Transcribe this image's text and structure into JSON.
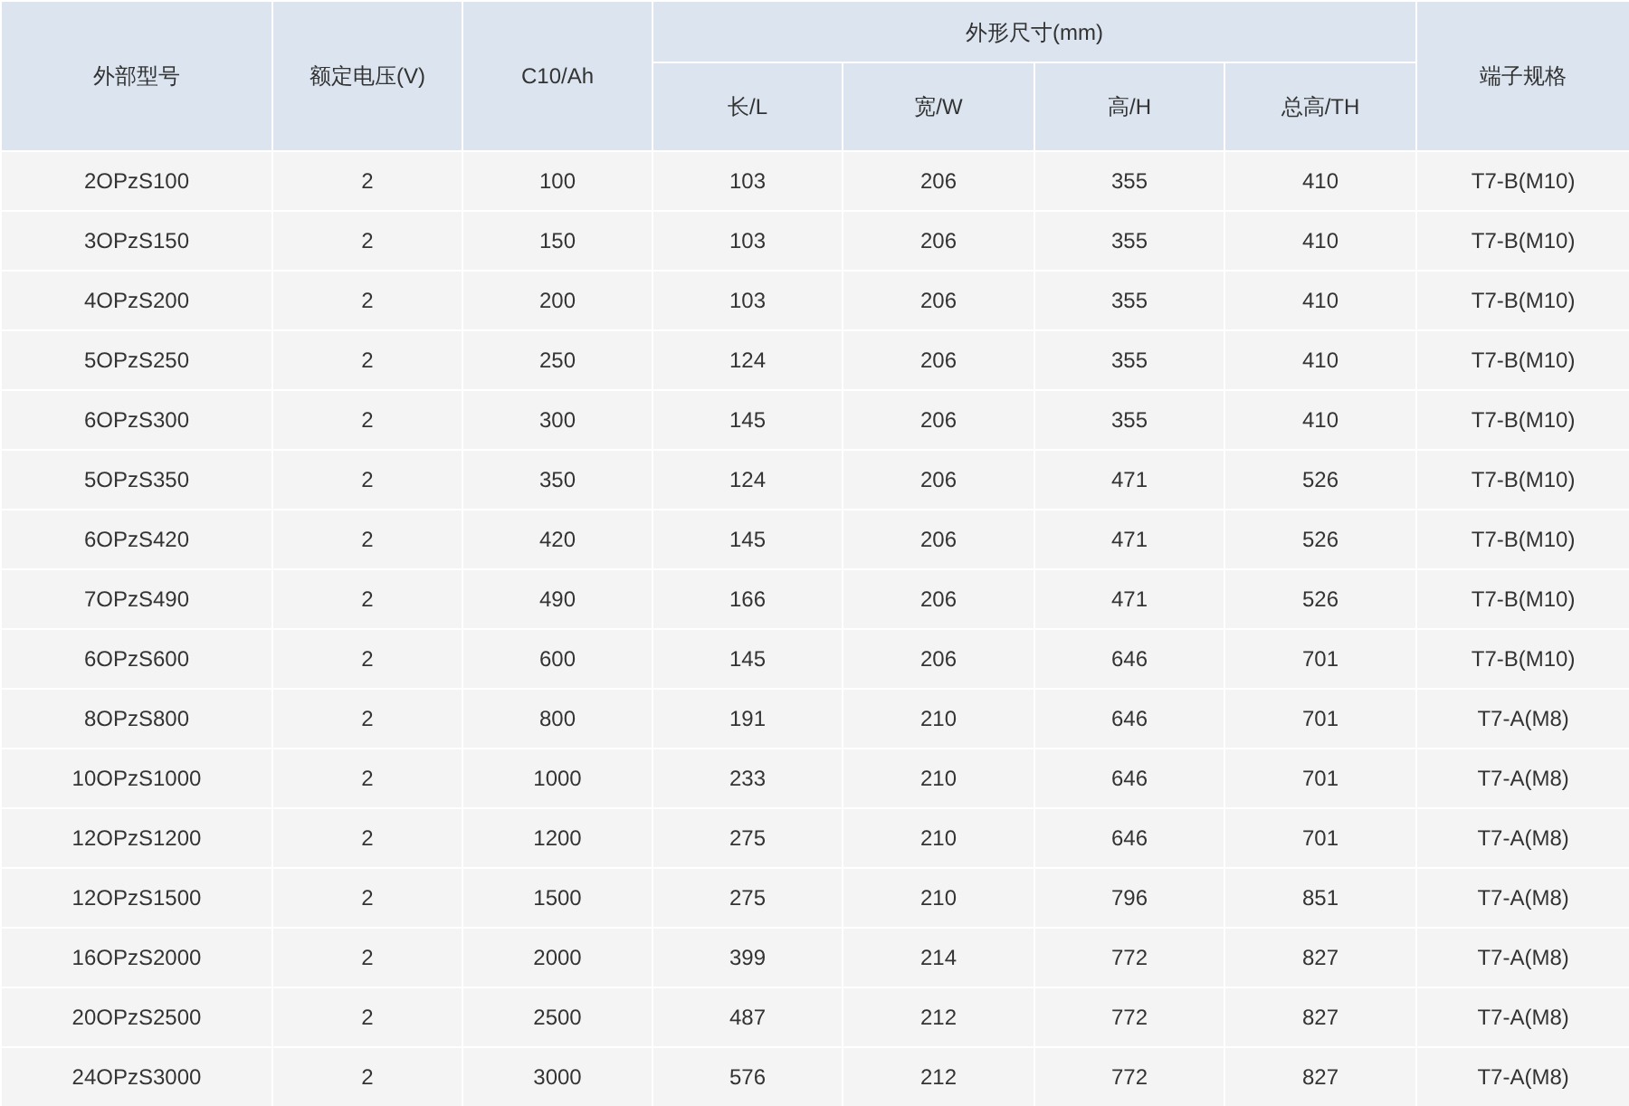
{
  "table": {
    "header_rows": [
      [
        {
          "label": "外部型号",
          "rowspan": 2
        },
        {
          "label": "额定电压(V)",
          "rowspan": 2
        },
        {
          "label": "C10/Ah",
          "rowspan": 2
        },
        {
          "label": "外形尺寸(mm)",
          "colspan": 4
        },
        {
          "label": "端子规格",
          "rowspan": 2
        }
      ],
      [
        {
          "label": "长/L"
        },
        {
          "label": "宽/W"
        },
        {
          "label": "高/H"
        },
        {
          "label": "总高/TH"
        }
      ]
    ],
    "rows": [
      [
        "2OPzS100",
        "2",
        "100",
        "103",
        "206",
        "355",
        "410",
        "T7-B(M10)"
      ],
      [
        "3OPzS150",
        "2",
        "150",
        "103",
        "206",
        "355",
        "410",
        "T7-B(M10)"
      ],
      [
        "4OPzS200",
        "2",
        "200",
        "103",
        "206",
        "355",
        "410",
        "T7-B(M10)"
      ],
      [
        "5OPzS250",
        "2",
        "250",
        "124",
        "206",
        "355",
        "410",
        "T7-B(M10)"
      ],
      [
        "6OPzS300",
        "2",
        "300",
        "145",
        "206",
        "355",
        "410",
        "T7-B(M10)"
      ],
      [
        "5OPzS350",
        "2",
        "350",
        "124",
        "206",
        "471",
        "526",
        "T7-B(M10)"
      ],
      [
        "6OPzS420",
        "2",
        "420",
        "145",
        "206",
        "471",
        "526",
        "T7-B(M10)"
      ],
      [
        "7OPzS490",
        "2",
        "490",
        "166",
        "206",
        "471",
        "526",
        "T7-B(M10)"
      ],
      [
        "6OPzS600",
        "2",
        "600",
        "145",
        "206",
        "646",
        "701",
        "T7-B(M10)"
      ],
      [
        "8OPzS800",
        "2",
        "800",
        "191",
        "210",
        "646",
        "701",
        "T7-A(M8)"
      ],
      [
        "10OPzS1000",
        "2",
        "1000",
        "233",
        "210",
        "646",
        "701",
        "T7-A(M8)"
      ],
      [
        "12OPzS1200",
        "2",
        "1200",
        "275",
        "210",
        "646",
        "701",
        "T7-A(M8)"
      ],
      [
        "12OPzS1500",
        "2",
        "1500",
        "275",
        "210",
        "796",
        "851",
        "T7-A(M8)"
      ],
      [
        "16OPzS2000",
        "2",
        "2000",
        "399",
        "214",
        "772",
        "827",
        "T7-A(M8)"
      ],
      [
        "20OPzS2500",
        "2",
        "2500",
        "487",
        "212",
        "772",
        "827",
        "T7-A(M8)"
      ],
      [
        "24OPzS3000",
        "2",
        "3000",
        "576",
        "212",
        "772",
        "827",
        "T7-A(M8)"
      ]
    ]
  }
}
